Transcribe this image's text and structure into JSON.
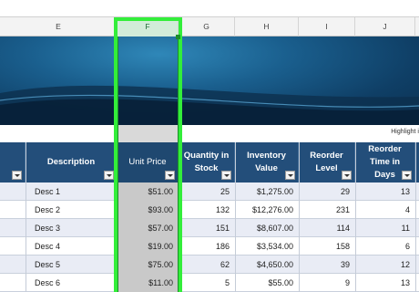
{
  "column_headers": [
    {
      "key": "E",
      "label": "E"
    },
    {
      "key": "F",
      "label": "F"
    },
    {
      "key": "G",
      "label": "G"
    },
    {
      "key": "H",
      "label": "H"
    },
    {
      "key": "I",
      "label": "I"
    },
    {
      "key": "J",
      "label": "J"
    }
  ],
  "note": "Highlight i",
  "table": {
    "headers": {
      "description": "Description",
      "unit_price": "Unit Price",
      "quantity": "Quantity in Stock",
      "inventory_value": "Inventory Value",
      "reorder_level": "Reorder Level",
      "reorder_time": "Reorder Time in Days"
    },
    "rows": [
      {
        "description": "Desc 1",
        "unit_price": "$51.00",
        "quantity": "25",
        "inventory_value": "$1,275.00",
        "reorder_level": "29",
        "reorder_time": "13"
      },
      {
        "description": "Desc 2",
        "unit_price": "$93.00",
        "quantity": "132",
        "inventory_value": "$12,276.00",
        "reorder_level": "231",
        "reorder_time": "4"
      },
      {
        "description": "Desc 3",
        "unit_price": "$57.00",
        "quantity": "151",
        "inventory_value": "$8,607.00",
        "reorder_level": "114",
        "reorder_time": "11"
      },
      {
        "description": "Desc 4",
        "unit_price": "$19.00",
        "quantity": "186",
        "inventory_value": "$3,534.00",
        "reorder_level": "158",
        "reorder_time": "6"
      },
      {
        "description": "Desc 5",
        "unit_price": "$75.00",
        "quantity": "62",
        "inventory_value": "$4,650.00",
        "reorder_level": "39",
        "reorder_time": "12"
      },
      {
        "description": "Desc 6",
        "unit_price": "$11.00",
        "quantity": "5",
        "inventory_value": "$55.00",
        "reorder_level": "9",
        "reorder_time": "13"
      }
    ]
  },
  "colors": {
    "selection_highlight": "#33ee3a",
    "header_fill": "#234e7a",
    "banded_row": "#e9ecf5",
    "selected_column_fill": "#c9c9c9"
  }
}
